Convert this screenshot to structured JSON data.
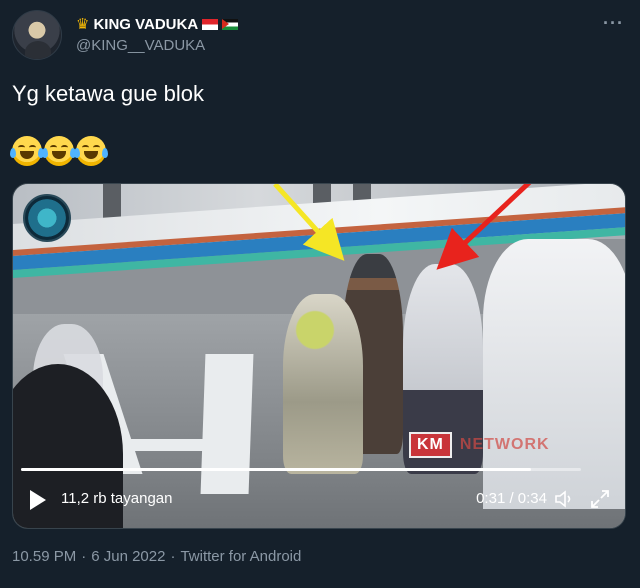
{
  "header": {
    "display_name": "KING VADUKA",
    "handle": "@KING__VADUKA",
    "more_label": "···"
  },
  "tweet": {
    "text": "Yg ketawa gue blok",
    "emojis": [
      "face-with-tears-of-joy",
      "face-with-tears-of-joy",
      "face-with-tears-of-joy"
    ]
  },
  "video": {
    "watermark_box": "KM",
    "watermark_text": "NETWORK",
    "views": "11,2 rb tayangan",
    "time": "0:31 / 0:34",
    "progress": 0.91,
    "arrow_colors": [
      "#f5e625",
      "#e8231d"
    ]
  },
  "footer": {
    "time": "10.59 PM",
    "dot1": "·",
    "date": "6 Jun 2022",
    "dot2": "·",
    "source": "Twitter for Android"
  },
  "colors": {
    "background": "#15202b",
    "secondary_text": "#8b98a5",
    "border": "#38444d"
  }
}
